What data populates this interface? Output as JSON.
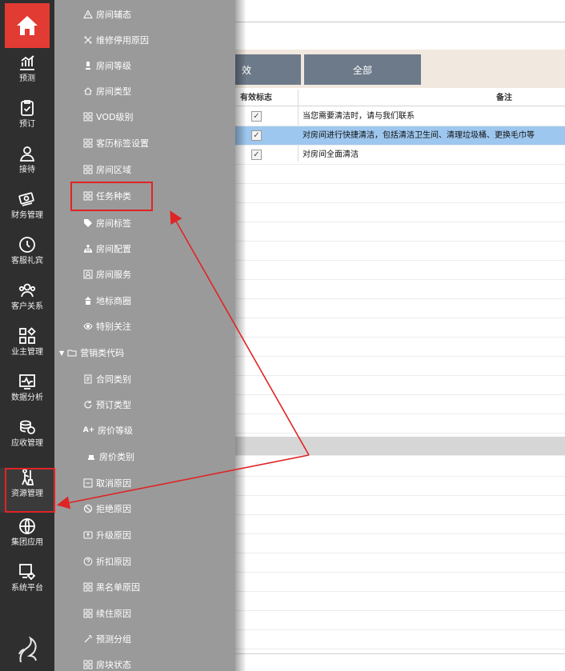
{
  "rail": {
    "items": [
      {
        "label": "预测",
        "icon": "chart-icon"
      },
      {
        "label": "预订",
        "icon": "clipboard-check-icon"
      },
      {
        "label": "接待",
        "icon": "user-icon"
      },
      {
        "label": "财务管理",
        "icon": "money-icon"
      },
      {
        "label": "客服礼宾",
        "icon": "clock-icon"
      },
      {
        "label": "客户关系",
        "icon": "users-icon"
      },
      {
        "label": "业主管理",
        "icon": "grid-icon"
      },
      {
        "label": "数据分析",
        "icon": "pulse-icon"
      },
      {
        "label": "应收管理",
        "icon": "coins-icon"
      },
      {
        "label": "资源管理",
        "icon": "cleaner-icon"
      },
      {
        "label": "集团应用",
        "icon": "globe-icon"
      },
      {
        "label": "系统平台",
        "icon": "settings-monitor-icon"
      }
    ]
  },
  "submenu": {
    "items": [
      {
        "label": "房间辅态",
        "icon": "warning-icon"
      },
      {
        "label": "维修停用原因",
        "icon": "tools-icon"
      },
      {
        "label": "房间等级",
        "icon": "medal-icon"
      },
      {
        "label": "房间类型",
        "icon": "house-icon"
      },
      {
        "label": "VOD级别",
        "icon": "apps-icon"
      },
      {
        "label": "客历标签设置",
        "icon": "apps-icon"
      },
      {
        "label": "房间区域",
        "icon": "apps-icon"
      },
      {
        "label": "任务种类",
        "icon": "apps-icon"
      },
      {
        "label": "房间标签",
        "icon": "tag-icon"
      },
      {
        "label": "房间配置",
        "icon": "hierarchy-icon"
      },
      {
        "label": "房间服务",
        "icon": "service-icon"
      },
      {
        "label": "地标商圈",
        "icon": "landmark-icon"
      },
      {
        "label": "特别关注",
        "icon": "eye-icon"
      },
      {
        "label": "营销类代码",
        "icon": "folder-icon",
        "expanded": true
      },
      {
        "label": "合同类别",
        "icon": "document-icon"
      },
      {
        "label": "预订类型",
        "icon": "refresh-icon"
      },
      {
        "label": "房价等级",
        "icon": "a-plus-icon"
      },
      {
        "label": "房价类别",
        "icon": "bed-icon"
      },
      {
        "label": "取消原因",
        "icon": "minus-box-icon"
      },
      {
        "label": "拒绝原因",
        "icon": "ban-icon"
      },
      {
        "label": "升级原因",
        "icon": "upgrade-icon"
      },
      {
        "label": "折扣原因",
        "icon": "question-icon"
      },
      {
        "label": "黑名单原因",
        "icon": "apps-icon"
      },
      {
        "label": "续住原因",
        "icon": "apps-icon"
      },
      {
        "label": "预测分组",
        "icon": "wand-icon"
      },
      {
        "label": "房块状态",
        "icon": "blocks-icon"
      }
    ]
  },
  "toolbar": {
    "partial_button_label": "效",
    "all_button_label": "全部"
  },
  "table": {
    "headers": {
      "active_flag": "有效标志",
      "remark": "备注"
    },
    "rows": [
      {
        "checked": true,
        "remark": "当您需要清洁时，请与我们联系"
      },
      {
        "checked": true,
        "remark": "对房间进行快捷清洁，包括清洁卫生间、清理垃圾桶、更换毛巾等"
      },
      {
        "checked": true,
        "remark": "对房间全面清洁"
      }
    ]
  },
  "colors": {
    "rail_bg": "#2f2f2f",
    "home_red": "#e23b33",
    "submenu_bg": "#9a9a9a",
    "button_bg": "#6d7a8a",
    "selected_row": "#9ec7ef",
    "annotation_red": "#e02424"
  }
}
